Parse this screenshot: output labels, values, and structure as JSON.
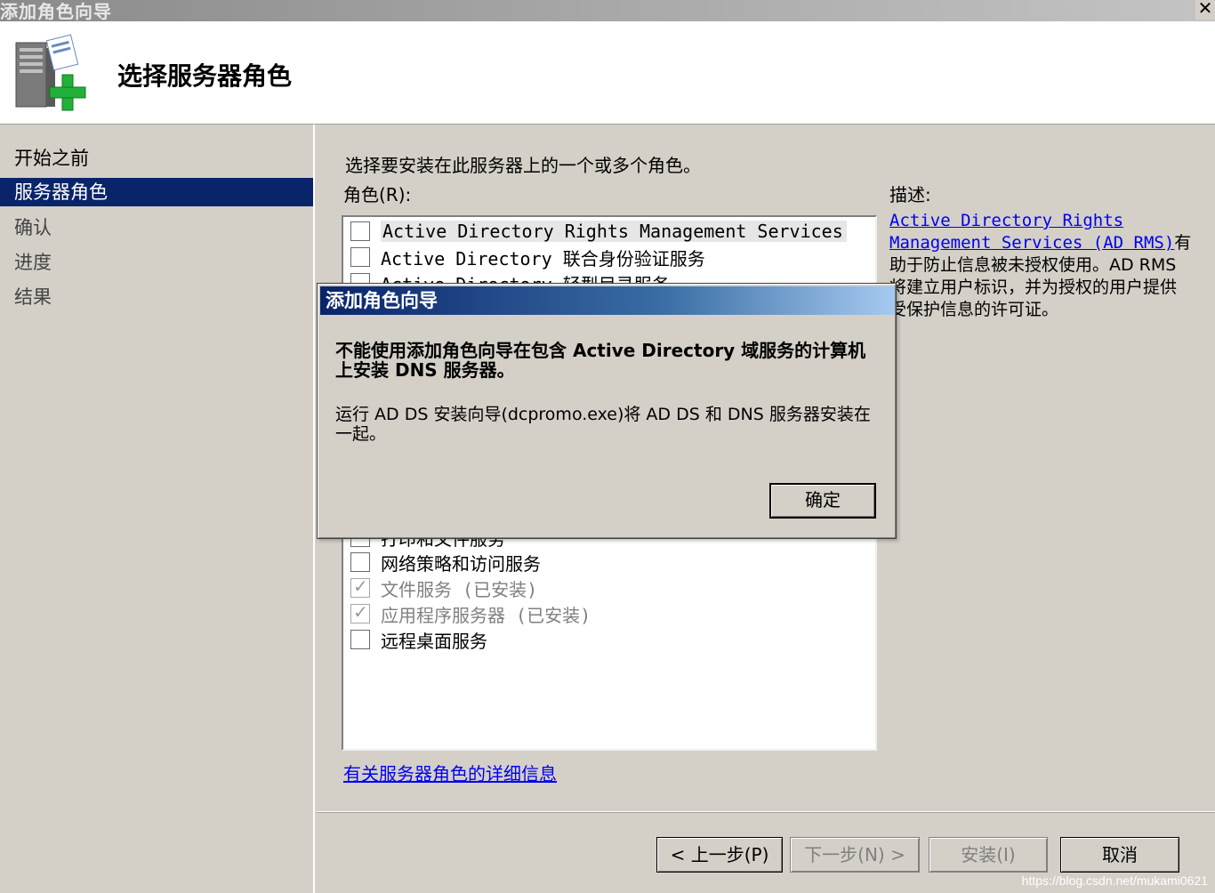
{
  "window": {
    "title": "添加角色向导",
    "close": "✕"
  },
  "header": {
    "title": "选择服务器角色",
    "icon": "server-add-icon"
  },
  "nav": {
    "items": [
      {
        "label": "开始之前",
        "state": "done"
      },
      {
        "label": "服务器角色",
        "state": "active"
      },
      {
        "label": "确认",
        "state": "pending"
      },
      {
        "label": "进度",
        "state": "pending"
      },
      {
        "label": "结果",
        "state": "pending"
      }
    ]
  },
  "content": {
    "intro": "选择要安装在此服务器上的一个或多个角色。",
    "roles_label": "角色(R):",
    "description_label": "描述:",
    "roles": [
      {
        "label": "Active Directory Rights Management Services",
        "checked": false,
        "disabled": false,
        "selected": true
      },
      {
        "label": "Active Directory 联合身份验证服务",
        "checked": false,
        "disabled": false
      },
      {
        "label": "Active Directory 轻型目录服务",
        "checked": false,
        "disabled": false
      },
      {
        "label": "打印和文件服务",
        "checked": false,
        "disabled": false
      },
      {
        "label": "网络策略和访问服务",
        "checked": false,
        "disabled": false
      },
      {
        "label": "文件服务  (已安装)",
        "checked": true,
        "disabled": true
      },
      {
        "label": "应用程序服务器  (已安装)",
        "checked": true,
        "disabled": true
      },
      {
        "label": "远程桌面服务",
        "checked": false,
        "disabled": false
      }
    ],
    "more_info_link": "有关服务器角色的详细信息",
    "description": {
      "link_text": "Active Directory Rights Management Services (AD RMS)",
      "text": "有助于防止信息被未授权使用。AD RMS 将建立用户标识，并为授权的用户提供受保护信息的许可证。"
    }
  },
  "footer": {
    "back": "< 上一步(P)",
    "next": "下一步(N) >",
    "install": "安装(I)",
    "cancel": "取消"
  },
  "modal": {
    "title": "添加角色向导",
    "message_main": "不能使用添加角色向导在包含 Active Directory 域服务的计算机上安装 DNS 服务器。",
    "message_sub": "运行 AD DS 安装向导(dcpromo.exe)将 AD DS 和 DNS 服务器安装在一起。",
    "ok": "确定"
  },
  "watermark": "https://blog.csdn.net/mukami0621",
  "colors": {
    "nav_active": "#0a246a",
    "modal_title_start": "#0a246a",
    "modal_title_end": "#a6caf0",
    "link": "#0000ee"
  }
}
